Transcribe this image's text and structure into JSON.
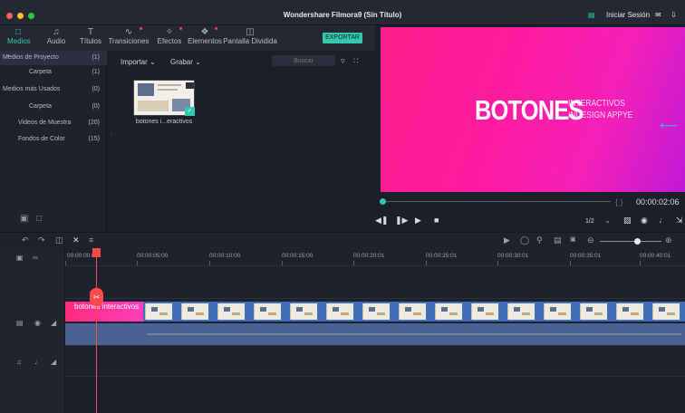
{
  "window": {
    "title": "Wondershare Filmora9 (Sin Título)",
    "signin_label": "Iniciar Sesión"
  },
  "toolbar": {
    "tabs": [
      {
        "label": "Medios",
        "icon": "folder-icon",
        "active": true
      },
      {
        "label": "Audio",
        "icon": "music-note-icon",
        "active": false
      },
      {
        "label": "Títulos",
        "icon": "text-icon",
        "active": false
      },
      {
        "label": "Transiciones",
        "icon": "transition-icon",
        "active": false
      },
      {
        "label": "Efectos",
        "icon": "effects-icon",
        "active": false
      },
      {
        "label": "Elementos",
        "icon": "elements-icon",
        "active": false
      },
      {
        "label": "Pantalla Dividida",
        "icon": "split-screen-icon",
        "active": false
      }
    ],
    "export_label": "EXPORTAR"
  },
  "media_tree": [
    {
      "label": "Medios de Proyecto",
      "count": "(1)"
    },
    {
      "label": "Carpeta",
      "count": "(1)"
    },
    {
      "label": "Medios más Usados",
      "count": "(0)"
    },
    {
      "label": "Carpeta",
      "count": "(0)"
    },
    {
      "label": "Videos de Muestra",
      "count": "(20)"
    },
    {
      "label": "Fondos de Color",
      "count": "(15)"
    }
  ],
  "media": {
    "import_label": "Importar",
    "record_label": "Grabar",
    "search_placeholder": "Buscar",
    "item_caption": "botones i...eractivos"
  },
  "preview": {
    "title": "BOTONES",
    "subtitle_line1": "INTERACTIVOS",
    "subtitle_line2": "INDESIGN APPYE",
    "timecode": "00:00:02:06",
    "quality": "1/2"
  },
  "timeline": {
    "ruler": [
      "00:00:00:00",
      "00:00:05:00",
      "00:00:10:00",
      "00:00:15:00",
      "00:00:20:01",
      "00:00:25:01",
      "00:00:30:01",
      "00:00:35:01",
      "00:00:40:01"
    ],
    "title_clip_label": "botones interactivos"
  },
  "colors": {
    "accent": "#35c6ae",
    "playhead": "#ff4a4a",
    "title_clip": "#ff2b7c",
    "video_clip": "#3e6fb8",
    "audio_clip": "#5878b4"
  }
}
